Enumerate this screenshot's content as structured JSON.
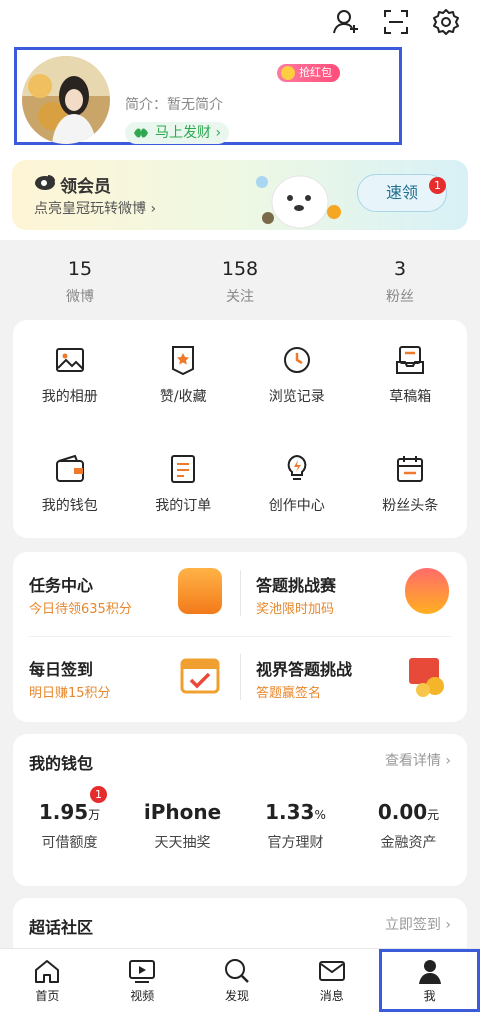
{
  "profile": {
    "bio": "简介：暂无简介",
    "hongbao_label": "抢红包",
    "fortune_label": "马上发财 ›"
  },
  "vip": {
    "title": "领会员",
    "subtitle": "点亮皇冠玩转微博 ›",
    "button": "速领",
    "badge": "1"
  },
  "stats": [
    {
      "num": "15",
      "label": "微博"
    },
    {
      "num": "158",
      "label": "关注"
    },
    {
      "num": "3",
      "label": "粉丝"
    }
  ],
  "grid": [
    {
      "label": "我的相册",
      "icon": "album-icon"
    },
    {
      "label": "赞/收藏",
      "icon": "favorite-icon"
    },
    {
      "label": "浏览记录",
      "icon": "history-icon"
    },
    {
      "label": "草稿箱",
      "icon": "drafts-icon"
    },
    {
      "label": "我的钱包",
      "icon": "wallet-icon"
    },
    {
      "label": "我的订单",
      "icon": "orders-icon"
    },
    {
      "label": "创作中心",
      "icon": "creator-icon"
    },
    {
      "label": "粉丝头条",
      "icon": "fans-headline-icon"
    }
  ],
  "tasks": [
    {
      "title": "任务中心",
      "sub": "今日待领635积分"
    },
    {
      "title": "答题挑战赛",
      "sub": "奖池限时加码"
    },
    {
      "title": "每日签到",
      "sub": "明日赚15积分"
    },
    {
      "title": "视界答题挑战",
      "sub": "答题赢签名"
    }
  ],
  "wallet": {
    "title": "我的钱包",
    "more": "查看详情 ›",
    "badge": "1",
    "items": [
      {
        "value": "1.95",
        "unit": "万",
        "label": "可借额度"
      },
      {
        "value": "iPhone",
        "unit": "",
        "label": "天天抽奖"
      },
      {
        "value": "1.33",
        "unit": "%",
        "label": "官方理财"
      },
      {
        "value": "0.00",
        "unit": "元",
        "label": "金融资产"
      }
    ]
  },
  "topic": {
    "title": "超话社区",
    "more": "立即签到 ›"
  },
  "tabs": [
    {
      "label": "首页",
      "icon": "home-icon"
    },
    {
      "label": "视频",
      "icon": "video-icon"
    },
    {
      "label": "发现",
      "icon": "discover-icon"
    },
    {
      "label": "消息",
      "icon": "message-icon"
    },
    {
      "label": "我",
      "icon": "me-icon"
    }
  ],
  "colors": {
    "accent": "#e8882e",
    "green": "#2fa84f",
    "badge": "#e62c2c",
    "highlight": "#3b5bdb"
  }
}
